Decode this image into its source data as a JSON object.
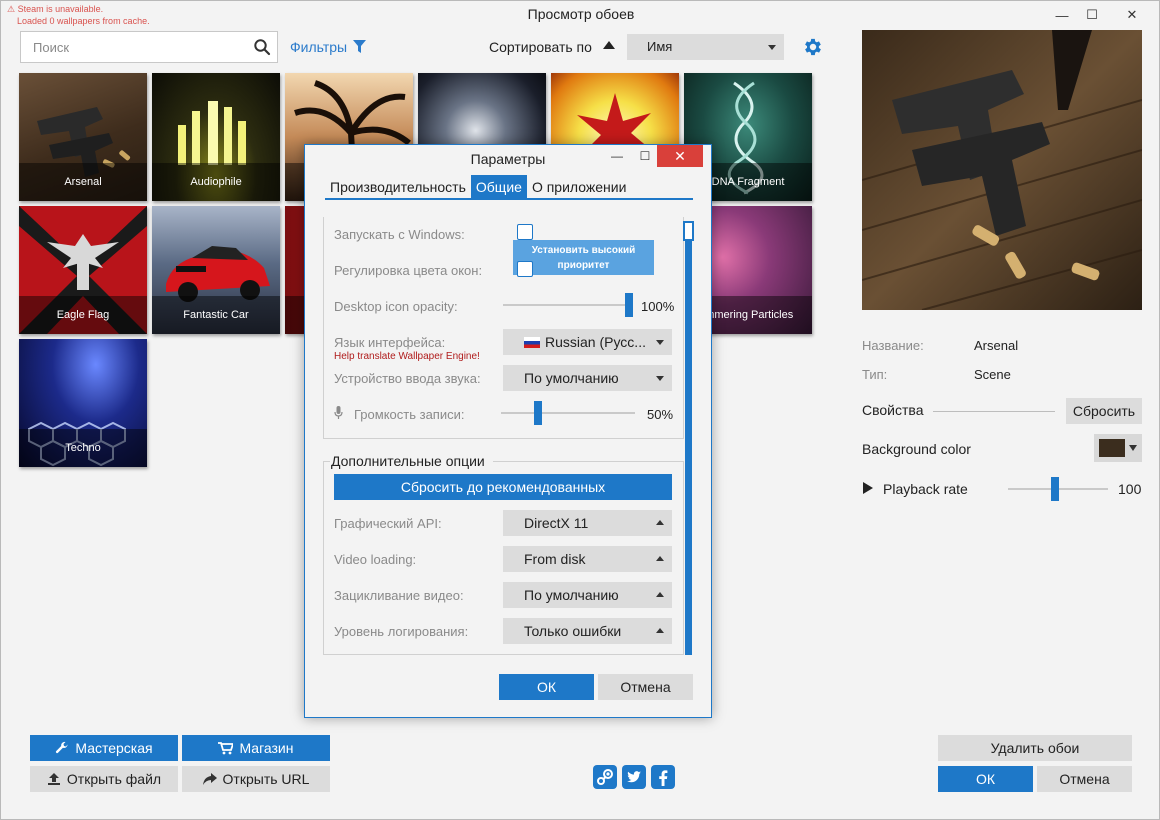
{
  "status": {
    "line1": "Steam is unavailable.",
    "line2": "Loaded 0 wallpapers from cache."
  },
  "window": {
    "title": "Просмотр обоев",
    "minimize": "—",
    "maximize": "☐",
    "close": "✕"
  },
  "search": {
    "placeholder": "Поиск"
  },
  "filters_label": "Фильтры",
  "sort": {
    "label": "Сортировать по",
    "value": "Имя"
  },
  "wallpapers": [
    {
      "name": "Arsenal"
    },
    {
      "name": "Audiophile"
    },
    {
      "name": ""
    },
    {
      "name": ""
    },
    {
      "name": ""
    },
    {
      "name": "DNA Fragment"
    },
    {
      "name": "Eagle Flag"
    },
    {
      "name": "Fantastic Car"
    },
    {
      "name": ""
    },
    {
      "name": "immering Particles"
    },
    {
      "name": "Techno"
    }
  ],
  "details": {
    "name_key": "Название:",
    "name_val": "Arsenal",
    "type_key": "Тип:",
    "type_val": "Scene",
    "properties_label": "Свойства",
    "reset_label": "Сбросить",
    "bg_color_label": "Background color",
    "bg_color": "#3b2d1e",
    "playback_label": "Playback rate",
    "playback_value": "100",
    "playback_fraction": 0.47
  },
  "bottom": {
    "workshop": "Мастерская",
    "store": "Магазин",
    "open_file": "Открыть файл",
    "open_url": "Открыть URL",
    "delete": "Удалить обои",
    "ok": "ОК",
    "cancel": "Отмена"
  },
  "dialog": {
    "title": "Параметры",
    "tabs": [
      "Производительность",
      "Общие",
      "О приложении"
    ],
    "active_tab": 1,
    "start_windows": "Запускать с Windows:",
    "window_color": "Регулировка цвета окон:",
    "tooltip": "Установить высокий приоритет",
    "icon_opacity_label": "Desktop icon opacity:",
    "icon_opacity_value": "100%",
    "icon_opacity_fraction": 1.0,
    "language_label": "Язык интерфейса:",
    "language_help": "Help translate Wallpaper Engine!",
    "language_value": "Russian (Русс...",
    "audio_device_label": "Устройство ввода звука:",
    "audio_device_value": "По умолчанию",
    "record_volume_label": "Громкость записи:",
    "record_volume_value": "50%",
    "record_volume_fraction": 0.26,
    "advanced_legend": "Дополнительные опции",
    "reset_recommended": "Сбросить до рекомендованных",
    "graphics_api_label": "Графический API:",
    "graphics_api_value": "DirectX 11",
    "video_loading_label": "Video loading:",
    "video_loading_value": "From disk",
    "video_loop_label": "Зацикливание видео:",
    "video_loop_value": "По умолчанию",
    "log_level_label": "Уровень логирования:",
    "log_level_value": "Только ошибки",
    "ok": "ОК",
    "cancel": "Отмена"
  },
  "colors": {
    "accent": "#1e78c8",
    "close_red": "#d9403a",
    "help_link": "#b01c1c"
  }
}
